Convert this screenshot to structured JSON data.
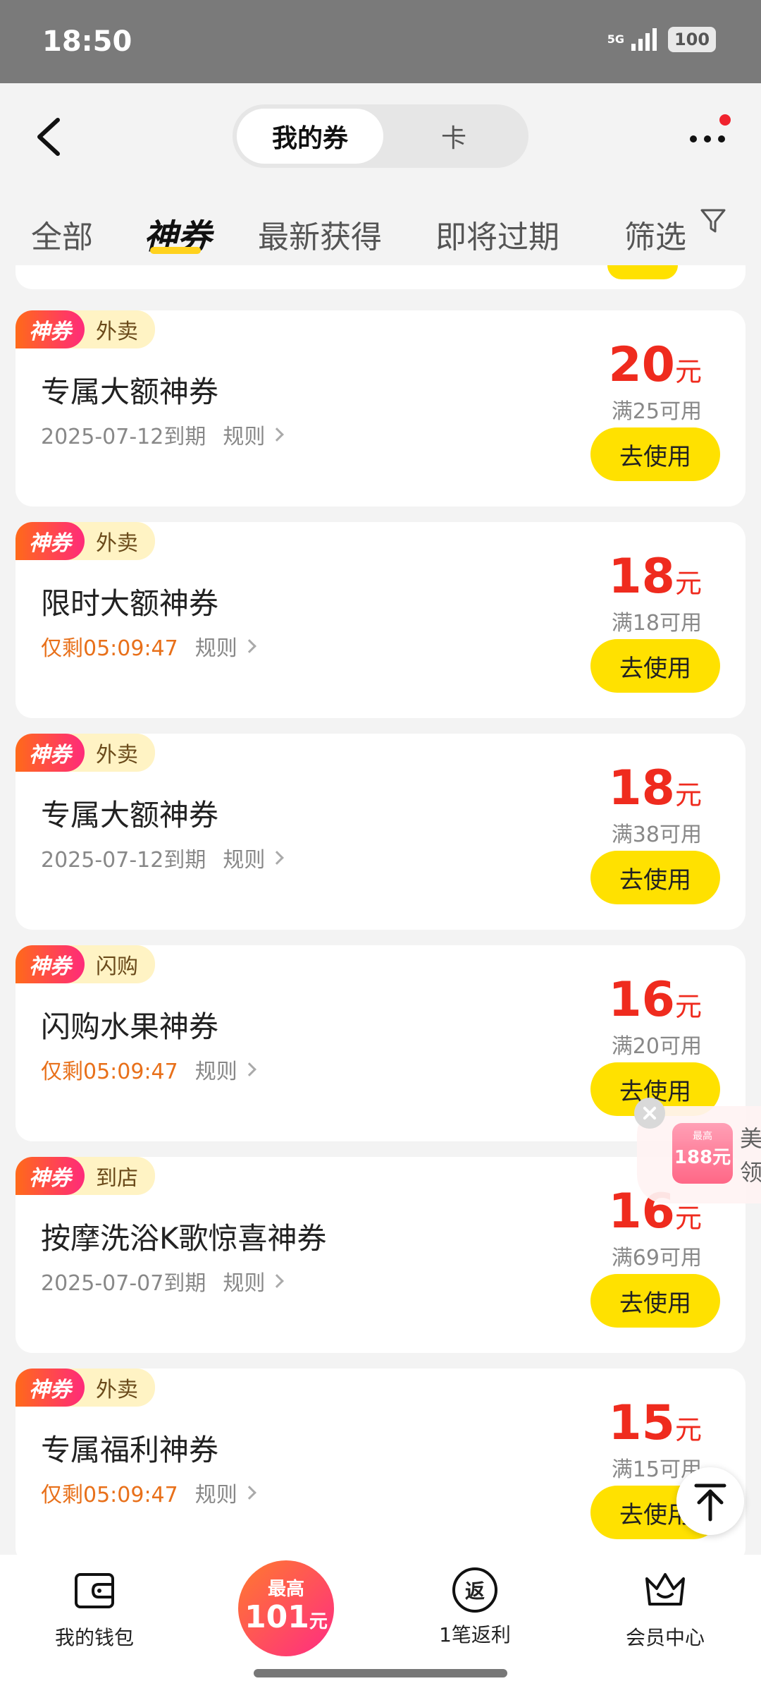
{
  "status_bar": {
    "time": "18:50",
    "network": "5G",
    "battery": "100"
  },
  "header": {
    "segments": {
      "active": "我的券",
      "inactive": "卡"
    },
    "tabs": [
      "全部",
      "神券",
      "最新获得",
      "即将过期",
      "筛选"
    ],
    "active_tab": "神券"
  },
  "coupons": [
    {
      "badge": "神券",
      "category": "外卖",
      "title": "专属大额神券",
      "expire": "2025-07-12到期",
      "urgent": false,
      "rules": "规则",
      "amount": "20",
      "unit": "元",
      "threshold": "满25可用",
      "button": "去使用"
    },
    {
      "badge": "神券",
      "category": "外卖",
      "title": "限时大额神券",
      "expire": "仅剩05:09:47",
      "urgent": true,
      "rules": "规则",
      "amount": "18",
      "unit": "元",
      "threshold": "满18可用",
      "button": "去使用"
    },
    {
      "badge": "神券",
      "category": "外卖",
      "title": "专属大额神券",
      "expire": "2025-07-12到期",
      "urgent": false,
      "rules": "规则",
      "amount": "18",
      "unit": "元",
      "threshold": "满38可用",
      "button": "去使用"
    },
    {
      "badge": "神券",
      "category": "闪购",
      "title": "闪购水果神券",
      "expire": "仅剩05:09:47",
      "urgent": true,
      "rules": "规则",
      "amount": "16",
      "unit": "元",
      "threshold": "满20可用",
      "button": "去使用"
    },
    {
      "badge": "神券",
      "category": "到店",
      "title": "按摩洗浴K歌惊喜神券",
      "expire": "2025-07-07到期",
      "urgent": false,
      "rules": "规则",
      "amount": "16",
      "unit": "元",
      "threshold": "满69可用",
      "button": "去使用"
    },
    {
      "badge": "神券",
      "category": "外卖",
      "title": "专属福利神券",
      "expire": "仅剩05:09:47",
      "urgent": true,
      "rules": "规则",
      "amount": "15",
      "unit": "元",
      "threshold": "满15可用",
      "button": "去使用"
    }
  ],
  "float_promo": {
    "top": "最高",
    "value": "188元",
    "text1": "美",
    "text2": "领"
  },
  "bottom_nav": {
    "wallet": "我的钱包",
    "center_top": "最高",
    "center_value": "101",
    "center_unit": "元",
    "rebate_icon_char": "返",
    "rebate": "1笔返利",
    "member": "会员中心"
  },
  "colors": {
    "accent_yellow": "#ffe100",
    "price_red": "#ef2b1e",
    "urgent_orange": "#e8701a",
    "badge_gradient": [
      "#ff6a1a",
      "#ff2a7a"
    ]
  }
}
